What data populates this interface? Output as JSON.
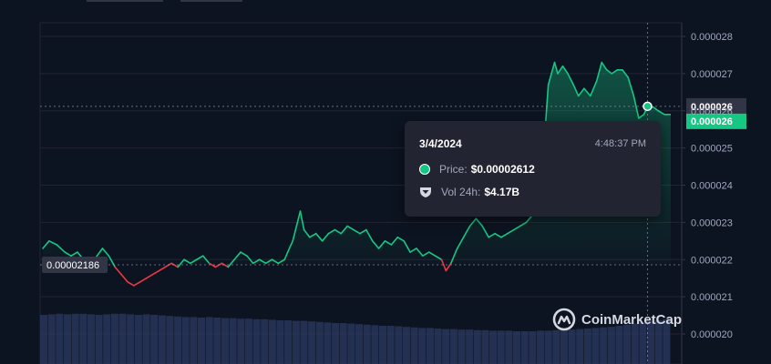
{
  "chart_data": {
    "type": "line",
    "series": [],
    "x_range": [
      0,
      1
    ],
    "ylim": [
      1.99e-05,
      2.84e-05
    ],
    "yticks": [
      {
        "value": 2.8e-05,
        "label": "0.000028"
      },
      {
        "value": 2.7e-05,
        "label": "0.000027"
      },
      {
        "value": 2.6e-05,
        "label": "0.000026"
      },
      {
        "value": 2.5e-05,
        "label": "0.000025"
      },
      {
        "value": 2.4e-05,
        "label": "0.000024"
      },
      {
        "value": 2.3e-05,
        "label": "0.000023"
      },
      {
        "value": 2.2e-05,
        "label": "0.000022"
      },
      {
        "value": 2.1e-05,
        "label": "0.000021"
      },
      {
        "value": 2e-05,
        "label": "0.000020"
      }
    ],
    "reference_price": {
      "value": 2.186e-05,
      "label": "0.00002186"
    },
    "crosshair_price": {
      "value": 2.612e-05,
      "label": "0.000026"
    },
    "current_price": {
      "value": 2.59e-05,
      "label": "0.000026"
    },
    "price_points": [
      [
        0.0,
        2.23e-05
      ],
      [
        0.01,
        2.25e-05
      ],
      [
        0.022,
        2.24e-05
      ],
      [
        0.035,
        2.22e-05
      ],
      [
        0.045,
        2.21e-05
      ],
      [
        0.055,
        2.22e-05
      ],
      [
        0.065,
        2.2e-05
      ],
      [
        0.072,
        2.18e-05
      ],
      [
        0.082,
        2.2e-05
      ],
      [
        0.095,
        2.23e-05
      ],
      [
        0.105,
        2.21e-05
      ],
      [
        0.115,
        2.18e-05
      ],
      [
        0.125,
        2.16e-05
      ],
      [
        0.135,
        2.14e-05
      ],
      [
        0.145,
        2.13e-05
      ],
      [
        0.155,
        2.14e-05
      ],
      [
        0.165,
        2.15e-05
      ],
      [
        0.175,
        2.16e-05
      ],
      [
        0.185,
        2.17e-05
      ],
      [
        0.195,
        2.18e-05
      ],
      [
        0.205,
        2.19e-05
      ],
      [
        0.215,
        2.18e-05
      ],
      [
        0.225,
        2.2e-05
      ],
      [
        0.235,
        2.19e-05
      ],
      [
        0.245,
        2.2e-05
      ],
      [
        0.255,
        2.21e-05
      ],
      [
        0.265,
        2.19e-05
      ],
      [
        0.275,
        2.18e-05
      ],
      [
        0.285,
        2.19e-05
      ],
      [
        0.295,
        2.18e-05
      ],
      [
        0.305,
        2.2e-05
      ],
      [
        0.315,
        2.22e-05
      ],
      [
        0.325,
        2.21e-05
      ],
      [
        0.335,
        2.19e-05
      ],
      [
        0.345,
        2.2e-05
      ],
      [
        0.355,
        2.19e-05
      ],
      [
        0.365,
        2.2e-05
      ],
      [
        0.375,
        2.19e-05
      ],
      [
        0.385,
        2.2e-05
      ],
      [
        0.39,
        2.22e-05
      ],
      [
        0.398,
        2.25e-05
      ],
      [
        0.404,
        2.29e-05
      ],
      [
        0.41,
        2.33e-05
      ],
      [
        0.416,
        2.28e-05
      ],
      [
        0.425,
        2.26e-05
      ],
      [
        0.435,
        2.27e-05
      ],
      [
        0.445,
        2.25e-05
      ],
      [
        0.455,
        2.27e-05
      ],
      [
        0.465,
        2.28e-05
      ],
      [
        0.475,
        2.27e-05
      ],
      [
        0.485,
        2.29e-05
      ],
      [
        0.495,
        2.28e-05
      ],
      [
        0.505,
        2.27e-05
      ],
      [
        0.515,
        2.28e-05
      ],
      [
        0.525,
        2.25e-05
      ],
      [
        0.535,
        2.23e-05
      ],
      [
        0.545,
        2.25e-05
      ],
      [
        0.555,
        2.24e-05
      ],
      [
        0.565,
        2.26e-05
      ],
      [
        0.575,
        2.25e-05
      ],
      [
        0.585,
        2.22e-05
      ],
      [
        0.595,
        2.23e-05
      ],
      [
        0.605,
        2.21e-05
      ],
      [
        0.615,
        2.22e-05
      ],
      [
        0.625,
        2.21e-05
      ],
      [
        0.635,
        2.2e-05
      ],
      [
        0.642,
        2.17e-05
      ],
      [
        0.65,
        2.19e-05
      ],
      [
        0.66,
        2.23e-05
      ],
      [
        0.67,
        2.26e-05
      ],
      [
        0.68,
        2.29e-05
      ],
      [
        0.69,
        2.31e-05
      ],
      [
        0.7,
        2.29e-05
      ],
      [
        0.71,
        2.26e-05
      ],
      [
        0.72,
        2.27e-05
      ],
      [
        0.73,
        2.26e-05
      ],
      [
        0.74,
        2.27e-05
      ],
      [
        0.75,
        2.28e-05
      ],
      [
        0.76,
        2.29e-05
      ],
      [
        0.77,
        2.3e-05
      ],
      [
        0.78,
        2.32e-05
      ],
      [
        0.79,
        2.34e-05
      ],
      [
        0.795,
        2.38e-05
      ],
      [
        0.8,
        2.55e-05
      ],
      [
        0.805,
        2.67e-05
      ],
      [
        0.81,
        2.7e-05
      ],
      [
        0.815,
        2.73e-05
      ],
      [
        0.82,
        2.7e-05
      ],
      [
        0.828,
        2.72e-05
      ],
      [
        0.836,
        2.7e-05
      ],
      [
        0.845,
        2.67e-05
      ],
      [
        0.853,
        2.64e-05
      ],
      [
        0.862,
        2.66e-05
      ],
      [
        0.872,
        2.64e-05
      ],
      [
        0.882,
        2.68e-05
      ],
      [
        0.89,
        2.73e-05
      ],
      [
        0.898,
        2.71e-05
      ],
      [
        0.906,
        2.7e-05
      ],
      [
        0.915,
        2.71e-05
      ],
      [
        0.923,
        2.71e-05
      ],
      [
        0.932,
        2.69e-05
      ],
      [
        0.941,
        2.64e-05
      ],
      [
        0.949,
        2.58e-05
      ],
      [
        0.957,
        2.59e-05
      ],
      [
        0.963,
        2.61e-05
      ],
      [
        0.972,
        2.61e-05
      ],
      [
        0.98,
        2.6e-05
      ],
      [
        0.99,
        2.59e-05
      ],
      [
        1.0,
        2.59e-05
      ]
    ],
    "crosshair_x": 0.963,
    "volume_bars": [
      0.9,
      0.91,
      0.92,
      0.91,
      0.92,
      0.92,
      0.91,
      0.9,
      0.91,
      0.92,
      0.92,
      0.91,
      0.9,
      0.91,
      0.9,
      0.89,
      0.88,
      0.87,
      0.86,
      0.86,
      0.85,
      0.86,
      0.85,
      0.84,
      0.84,
      0.83,
      0.83,
      0.82,
      0.82,
      0.81,
      0.8,
      0.8,
      0.79,
      0.79,
      0.78,
      0.77,
      0.76,
      0.75,
      0.75,
      0.74,
      0.73,
      0.72,
      0.71,
      0.7,
      0.7,
      0.69,
      0.68,
      0.67,
      0.66,
      0.66,
      0.65,
      0.64,
      0.64,
      0.63,
      0.63,
      0.62,
      0.62,
      0.61,
      0.61,
      0.61,
      0.6,
      0.6,
      0.6,
      0.61,
      0.61,
      0.62,
      0.62,
      0.63,
      0.64,
      0.65,
      0.66,
      0.67,
      0.68,
      0.7,
      0.72,
      0.74,
      0.76,
      0.78,
      0.8,
      0.82
    ],
    "colors": {
      "up": "#16c784",
      "down": "#ea3943",
      "grid": "#222531",
      "volume": "#2b3a63"
    }
  },
  "tooltip": {
    "date": "3/4/2024",
    "time": "4:48:37 PM",
    "price_label": "Price:",
    "price_value": "$0.00002612",
    "vol_label": "Vol 24h:",
    "vol_value": "$4.17B"
  },
  "watermark": {
    "text": "CoinMarketCap",
    "icon": "coinmarketcap-logo-icon"
  }
}
